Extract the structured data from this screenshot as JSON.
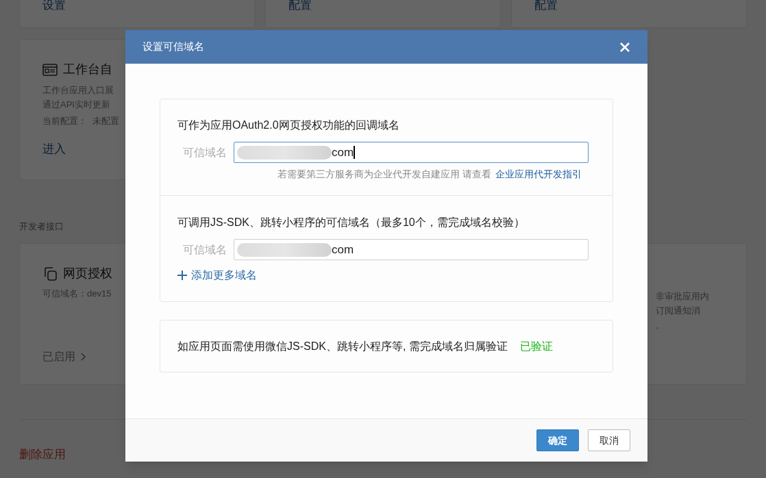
{
  "background": {
    "top_cards": [
      {
        "link": "设置"
      },
      {
        "link": "配置"
      },
      {
        "link": "配置"
      }
    ],
    "workbench_card": {
      "title": "工作台自",
      "description": [
        "工作台应用入口展",
        "通过API实时更新"
      ],
      "config_label": "当前配置：",
      "config_value": "未配置",
      "link": "进入"
    },
    "section_title": "开发者接口",
    "oauth_card": {
      "title": "网页授权",
      "domain": "可信域名：dev15",
      "status": "已启用"
    },
    "message_card": {
      "description": [
        "非审批应用内",
        "订阅通知消",
        "。"
      ]
    },
    "delete_link": "删除应用"
  },
  "dialog": {
    "title": "设置可信域名",
    "sections": [
      {
        "heading": "可作为应用OAuth2.0网页授权功能的回调域名",
        "field_label": "可信域名",
        "value": "com",
        "focused": true,
        "hint": "若需要第三方服务商为企业代开发自建应用 请查看",
        "hint_link": "企业应用代开发指引"
      },
      {
        "heading": "可调用JS-SDK、跳转小程序的可信域名（最多10个，需完成域名校验）",
        "field_label": "可信域名",
        "value": "com",
        "focused": false,
        "add_link": "添加更多域名"
      }
    ],
    "verification": {
      "text": "如应用页面需使用微信JS-SDK、跳转小程序等, 需完成域名归属验证",
      "status": "已验证",
      "verified": true
    },
    "buttons": [
      {
        "label": "确定",
        "kind": "primary"
      },
      {
        "label": "取消",
        "kind": "secondary"
      }
    ]
  }
}
